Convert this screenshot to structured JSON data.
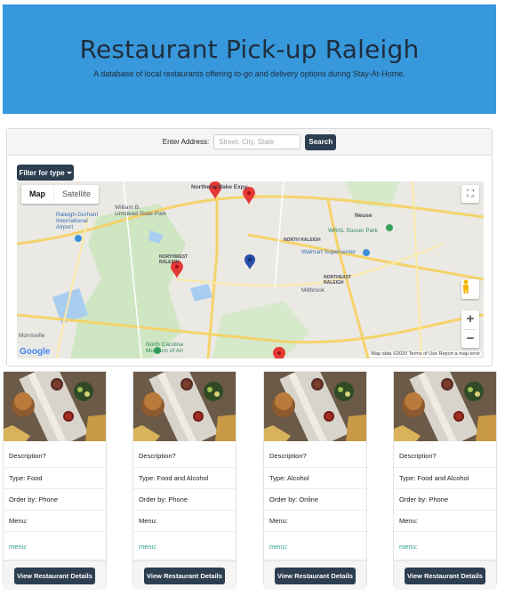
{
  "header": {
    "title": "Restaurant Pick-up Raleigh",
    "subtitle": "A database of local restaurants offering to-go and delivery options during Stay-At-Home."
  },
  "search": {
    "label": "Enter Address:",
    "placeholder": "Street, City, State",
    "button_label": "Search"
  },
  "filter": {
    "label": "Filter for type"
  },
  "map": {
    "type_buttons": [
      "Map",
      "Satellite"
    ],
    "zoom_in": "+",
    "zoom_out": "−",
    "logo": "Google",
    "attribution": "Map data ©2020  Terms of Use  Report a map error",
    "labels": {
      "neuse": "Neuse",
      "north_raleigh_top": "NORTH RALEIGH",
      "north_raleigh_mid": "NORTH RALEIGH",
      "northeast_raleigh": "NORTHEAST\nRALEIGH",
      "northwest_raleigh": "NORTHWEST\nRALEIGH",
      "airport": "Raleigh-Durham\nInternational\nAirport",
      "umstead": "William B.\nUmstead State Park",
      "wrал": "WRAL Soccer Park",
      "walmart": "Walmart Supercenter",
      "millbrook": "Millbrook",
      "morrisville": "Morrisville",
      "museum": "North Carolina\nMuseum of Art",
      "northern_wake": "Northern Wake Expy"
    },
    "colors": {
      "pin_red": "#e53935",
      "pin_blue": "#2a4fa8"
    }
  },
  "cards": [
    {
      "description": "Description?",
      "type": "Type: Food",
      "order": "Order by: Phone",
      "menu": "Menu:",
      "menu_link": "menu:",
      "button_label": "View Restaurant Details"
    },
    {
      "description": "Description?",
      "type": "Type: Food and Alcohol",
      "order": "Order by: Phone",
      "menu": "Menu:",
      "menu_link": "menu:",
      "button_label": "View Restaurant Details"
    },
    {
      "description": "Description?",
      "type": "Type: Alcohol",
      "order": "Order by: Online",
      "menu": "Menu:",
      "menu_link": "menu:",
      "button_label": "View Restaurant Details"
    },
    {
      "description": "Description?",
      "type": "Type: Food and Alcohol",
      "order": "Order by: Phone",
      "menu": "Menu:",
      "menu_link": "menu:",
      "button_label": "View Restaurant Details"
    }
  ],
  "colors": {
    "hero_bg": "#3798db",
    "button_dark": "#2c3e50",
    "link_green": "#2a9d8f"
  }
}
